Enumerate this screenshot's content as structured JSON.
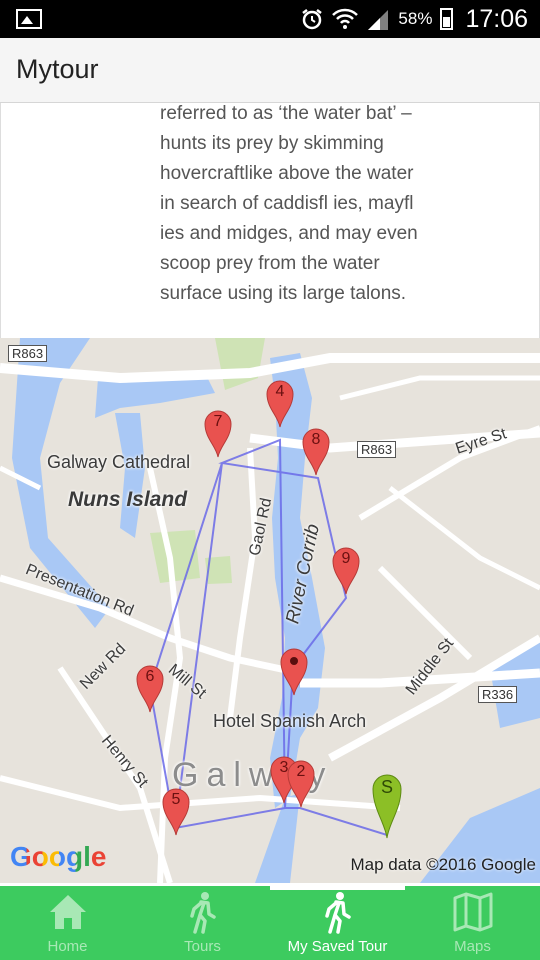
{
  "status_bar": {
    "battery": "58%",
    "time": "17:06"
  },
  "app": {
    "title": "Mytour"
  },
  "content": {
    "lines": [
      "referred to as ‘the water bat’ –",
      "hunts its prey by skimming",
      "hovercraftlike above the water",
      "in search of caddisfl ies, mayfl",
      "ies and midges, and may even",
      "scoop prey from the water",
      "surface using its large talons."
    ]
  },
  "map": {
    "labels": {
      "cathedral": "Galway Cathedral",
      "nuns_island": "Nuns Island",
      "gaol_rd": "Gaol Rd",
      "river": "River Corrib",
      "eyre": "Eyre St",
      "presentation": "Presentation Rd",
      "new_rd": "New Rd",
      "mill": "Mill St",
      "henry": "Henry St",
      "middle": "Middle St",
      "hotel": "Hotel Spanish Arch",
      "city": "Galway",
      "r863_a": "R863",
      "r863_b": "R863",
      "r336": "R336"
    },
    "pins": {
      "p4": "4",
      "p7": "7",
      "p8": "8",
      "p9": "9",
      "p6": "6",
      "p5": "5",
      "p3": "3",
      "p2": "2",
      "ps": "S"
    },
    "logo": "Google",
    "attribution": "Map data ©2016 Google"
  },
  "colors": {
    "tabbar": "#3dcb5f",
    "pin_red": "#e9524f",
    "pin_green": "#8cbf26",
    "water": "#a9c8f5"
  },
  "tabs": [
    {
      "label": "Home",
      "icon": "home-icon"
    },
    {
      "label": "Tours",
      "icon": "walker-icon"
    },
    {
      "label": "My Saved Tour",
      "icon": "walker-icon"
    },
    {
      "label": "Maps",
      "icon": "map-icon"
    }
  ]
}
